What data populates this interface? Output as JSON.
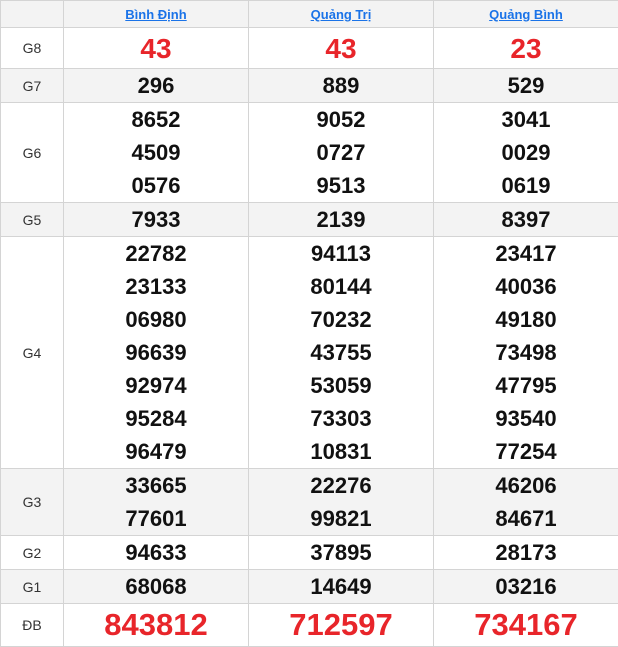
{
  "provinces": [
    "Bình Định",
    "Quảng Trị",
    "Quảng Bình"
  ],
  "prizes": {
    "G8": {
      "label": "G8",
      "values": [
        [
          "43"
        ],
        [
          "43"
        ],
        [
          "23"
        ]
      ]
    },
    "G7": {
      "label": "G7",
      "values": [
        [
          "296"
        ],
        [
          "889"
        ],
        [
          "529"
        ]
      ]
    },
    "G6": {
      "label": "G6",
      "values": [
        [
          "8652",
          "4509",
          "0576"
        ],
        [
          "9052",
          "0727",
          "9513"
        ],
        [
          "3041",
          "0029",
          "0619"
        ]
      ]
    },
    "G5": {
      "label": "G5",
      "values": [
        [
          "7933"
        ],
        [
          "2139"
        ],
        [
          "8397"
        ]
      ]
    },
    "G4": {
      "label": "G4",
      "values": [
        [
          "22782",
          "23133",
          "06980",
          "96639",
          "92974",
          "95284",
          "96479"
        ],
        [
          "94113",
          "80144",
          "70232",
          "43755",
          "53059",
          "73303",
          "10831"
        ],
        [
          "23417",
          "40036",
          "49180",
          "73498",
          "47795",
          "93540",
          "77254"
        ]
      ]
    },
    "G3": {
      "label": "G3",
      "values": [
        [
          "33665",
          "77601"
        ],
        [
          "22276",
          "99821"
        ],
        [
          "46206",
          "84671"
        ]
      ]
    },
    "G2": {
      "label": "G2",
      "values": [
        [
          "94633"
        ],
        [
          "37895"
        ],
        [
          "28173"
        ]
      ]
    },
    "G1": {
      "label": "G1",
      "values": [
        [
          "68068"
        ],
        [
          "14649"
        ],
        [
          "03216"
        ]
      ]
    },
    "DB": {
      "label": "ĐB",
      "values": [
        [
          "843812"
        ],
        [
          "712597"
        ],
        [
          "734167"
        ]
      ]
    }
  },
  "colors": {
    "highlight": "#e8252a",
    "link": "#1a73e8",
    "alt_row": "#f3f3f3"
  }
}
